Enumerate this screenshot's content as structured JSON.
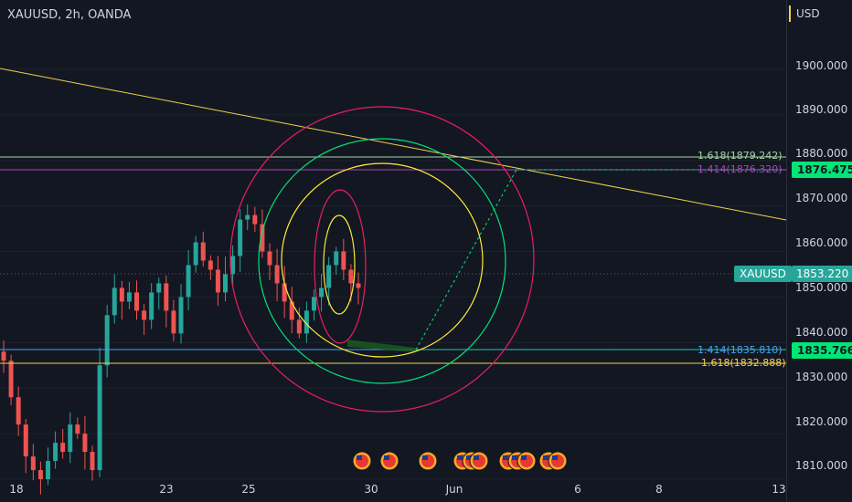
{
  "header": {
    "title": "XAUUSD, 2h, OANDA"
  },
  "price_scale": {
    "currency": "USD",
    "ticks": [
      "1900.000",
      "1890.000",
      "1880.000",
      "1870.000",
      "1860.000",
      "1850.000",
      "1840.000",
      "1830.000",
      "1820.000",
      "1810.000"
    ]
  },
  "time_scale": {
    "ticks": [
      "18",
      "23",
      "25",
      "30",
      "Jun",
      "6",
      "8",
      "13"
    ]
  },
  "badges": {
    "resistance": "1876.475",
    "support": "1835.766",
    "symbol": "XAUUSD",
    "last_price": "1853.220"
  },
  "fib_labels": {
    "upper_1618": "1.618(1879.242)",
    "upper_1414": "1.414(1876.320)",
    "lower_1414": "1.414(1835.810)",
    "lower_1618": "1.618(1832.888)"
  },
  "colors": {
    "bull": "#26a69a",
    "bear": "#ef5350",
    "trendline": "#f0d24a",
    "red_circle": "#e91e63",
    "green_circle": "#00e676",
    "yellow_circle": "#ffeb3b",
    "fib_green": "#a5d6a7",
    "fib_purple": "#ab47bc",
    "fib_blue": "#42a5f5",
    "badge_green": "#00e676"
  },
  "events": {
    "icon": "us-flag-icon",
    "count": 11
  },
  "chart_data": {
    "type": "candlestick",
    "title": "XAUUSD, 2h, OANDA",
    "ylim": [
      1808,
      1910
    ],
    "x_ticks": [
      "18",
      "23",
      "25",
      "30",
      "Jun",
      "6",
      "8",
      "13"
    ],
    "close_approx": [
      1836,
      1828,
      1822,
      1815,
      1812,
      1810,
      1814,
      1818,
      1816,
      1822,
      1820,
      1816,
      1812,
      1835,
      1846,
      1852,
      1849,
      1851,
      1847,
      1845,
      1851,
      1853,
      1847,
      1842,
      1850,
      1857,
      1862,
      1858,
      1856,
      1851,
      1855,
      1859,
      1867,
      1868,
      1866,
      1860,
      1857,
      1853,
      1849,
      1845,
      1842,
      1847,
      1850,
      1852,
      1857,
      1860,
      1856,
      1853,
      1852
    ],
    "lines": [
      {
        "type": "trendline",
        "from": [
          1899,
          "start"
        ],
        "to": [
          1865,
          "end"
        ]
      },
      {
        "type": "horizontal",
        "price": 1879.242,
        "label": "1.618(1879.242)"
      },
      {
        "type": "horizontal",
        "price": 1876.32,
        "label": "1.414(1876.320)"
      },
      {
        "type": "horizontal",
        "price": 1835.81,
        "label": "1.414(1835.810)"
      },
      {
        "type": "horizontal",
        "price": 1832.888,
        "label": "1.618(1832.888)"
      }
    ],
    "last_price": 1853.22
  }
}
